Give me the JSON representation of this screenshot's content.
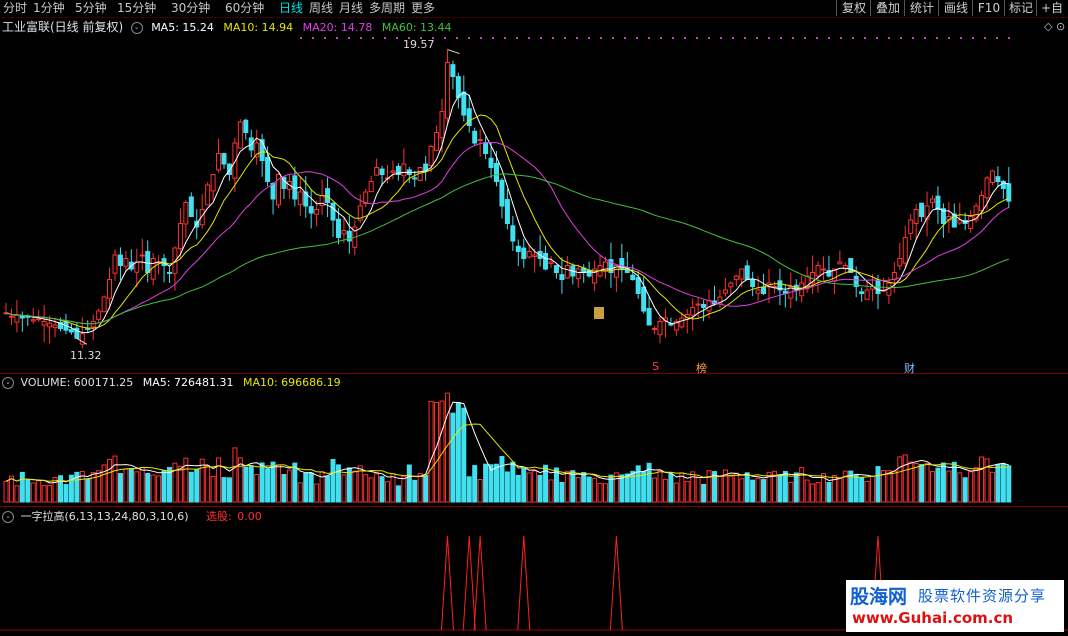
{
  "toolbar": {
    "periods": [
      "分时",
      "1分钟",
      "5分钟",
      "15分钟",
      "30分钟",
      "60分钟",
      "日线",
      "周线",
      "月线",
      "多周期",
      "更多"
    ],
    "active_period": "日线",
    "right_buttons": [
      "复权",
      "叠加",
      "统计",
      "画线",
      "F10",
      "标记",
      "+自"
    ]
  },
  "price_panel": {
    "title": "工业富联(日线 前复权)",
    "ma5": "MA5: 15.24",
    "ma10": "MA10: 14.94",
    "ma20": "MA20: 14.78",
    "ma60": "MA60: 13.44",
    "high_label": "19.57",
    "low_label": "11.32",
    "markers": [
      "S",
      "榜",
      "财"
    ],
    "colors": {
      "ma5": "#ffffff",
      "ma10": "#e6e600",
      "ma20": "#e040e0",
      "ma60": "#40c040",
      "up": "#ff3030",
      "down": "#40e0f0"
    }
  },
  "volume_panel": {
    "volume": "VOLUME: 600171.25",
    "ma5": "MA5: 726481.31",
    "ma10": "MA10: 696686.19"
  },
  "indicator_panel": {
    "name": "一字拉高(6,13,13,24,80,3,10,6)",
    "label": "选股:",
    "value": "0.00"
  },
  "watermark": {
    "line1": "股海网",
    "line2": "股票软件资源分享",
    "line3": "www.Guhai.com.cn"
  },
  "chart_data": {
    "type": "candlestick",
    "closes": [
      12.05,
      11.95,
      11.98,
      11.9,
      11.92,
      11.85,
      11.88,
      11.8,
      11.75,
      11.7,
      11.6,
      11.55,
      11.5,
      11.32,
      11.45,
      11.6,
      11.8,
      12.1,
      12.5,
      13.0,
      13.7,
      13.4,
      13.6,
      13.3,
      13.5,
      13.7,
      13.2,
      13.6,
      13.5,
      13.4,
      13.2,
      13.9,
      14.6,
      15.2,
      14.8,
      14.5,
      15.0,
      15.7,
      16.0,
      16.6,
      16.3,
      16.0,
      16.9,
      17.5,
      17.2,
      16.7,
      16.9,
      16.4,
      15.8,
      15.3,
      16.0,
      15.6,
      15.8,
      15.3,
      15.5,
      15.1,
      14.9,
      15.0,
      15.4,
      15.2,
      14.7,
      14.2,
      14.4,
      14.1,
      14.5,
      15.1,
      15.5,
      15.8,
      16.2,
      16.0,
      15.9,
      16.1,
      16.0,
      16.3,
      16.0,
      15.9,
      16.2,
      16.1,
      16.8,
      17.2,
      17.8,
      19.2,
      18.8,
      18.2,
      17.7,
      17.4,
      16.9,
      17.0,
      16.6,
      16.2,
      15.8,
      15.1,
      14.6,
      14.1,
      13.8,
      13.6,
      13.8,
      13.7,
      13.6,
      13.3,
      13.5,
      13.2,
      13.0,
      13.4,
      13.1,
      13.3,
      13.2,
      13.1,
      13.3,
      13.4,
      13.5,
      13.2,
      13.4,
      13.3,
      13.2,
      13.0,
      12.6,
      12.1,
      11.7,
      11.6,
      11.8,
      11.9,
      11.7,
      11.8,
      11.9,
      12.0,
      12.2,
      12.3,
      12.2,
      12.4,
      12.3,
      12.5,
      12.7,
      12.9,
      13.1,
      13.3,
      13.0,
      12.8,
      12.7,
      12.6,
      12.9,
      12.8,
      12.7,
      12.6,
      12.8,
      12.7,
      12.9,
      13.1,
      13.2,
      13.4,
      13.3,
      13.1,
      13.3,
      13.5,
      13.4,
      13.2,
      12.8,
      12.6,
      12.7,
      12.8,
      12.6,
      12.7,
      12.9,
      13.2,
      13.6,
      14.2,
      14.7,
      15.0,
      14.8,
      15.1,
      15.3,
      15.0,
      14.6,
      14.8,
      14.5,
      14.7,
      14.6,
      14.8,
      15.1,
      15.4,
      15.9,
      16.1,
      15.8,
      15.6,
      15.24
    ]
  }
}
